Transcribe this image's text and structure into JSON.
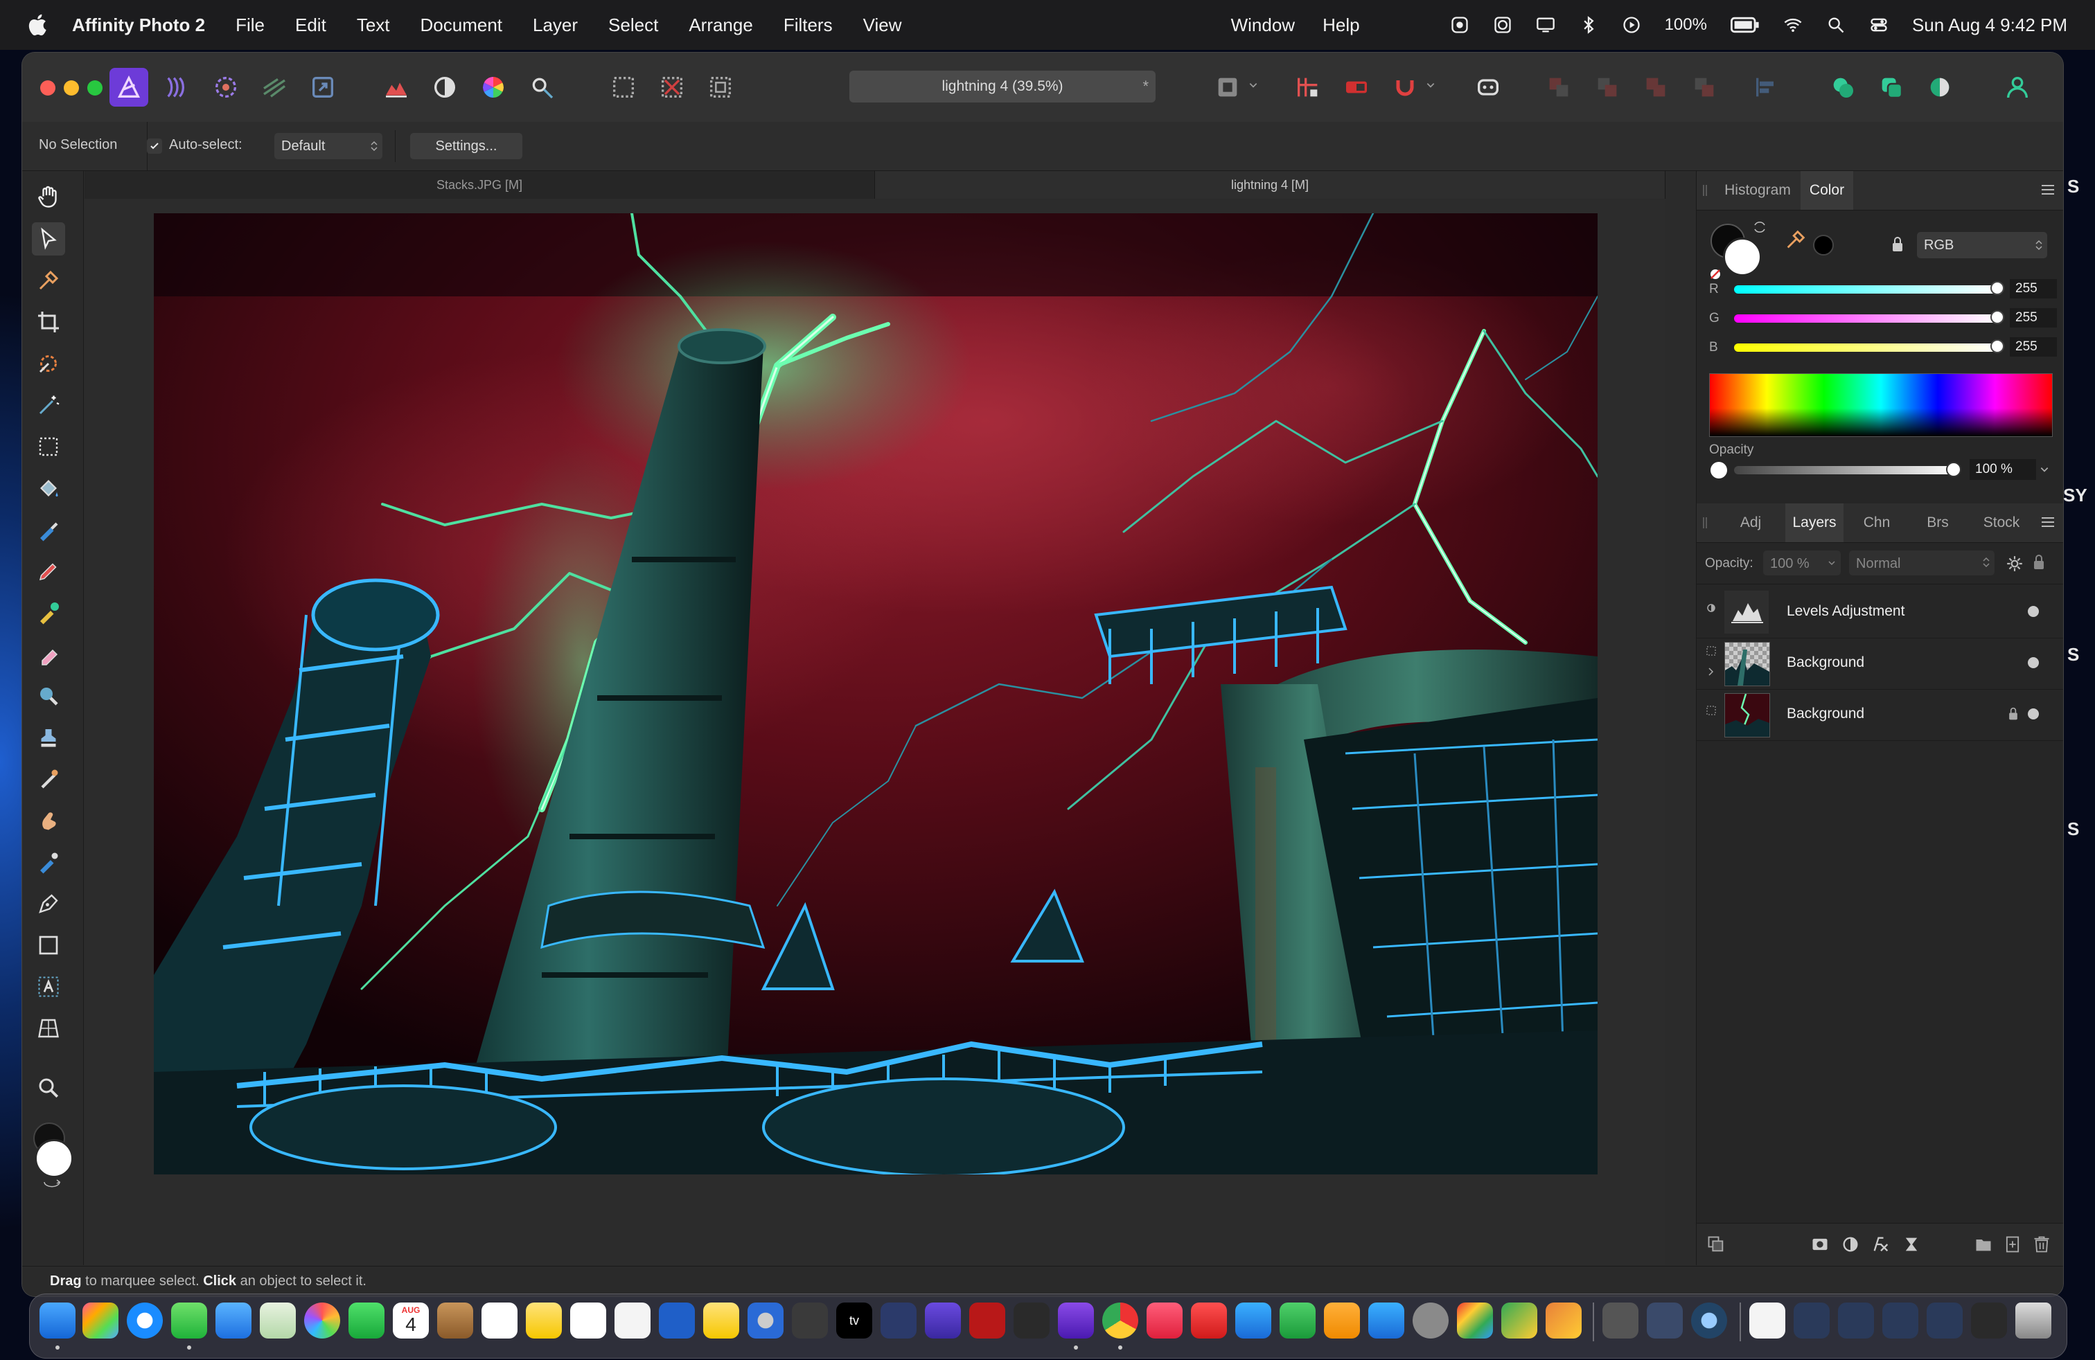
{
  "menubar": {
    "app_name": "Affinity Photo 2",
    "menus": [
      "File",
      "Edit",
      "Text",
      "Document",
      "Layer",
      "Select",
      "Arrange",
      "Filters",
      "View"
    ],
    "right_menus": [
      "Window",
      "Help"
    ],
    "battery": "100%",
    "datetime": "Sun Aug 4  9:42 PM"
  },
  "titlebar": {
    "document_title": "lightning 4 (39.5%)",
    "title_star": "*"
  },
  "contextbar": {
    "selection_status": "No Selection",
    "auto_select_label": "Auto-select:",
    "auto_select_value": "Default",
    "settings_label": "Settings..."
  },
  "document_tabs": [
    {
      "label": "Stacks.JPG [M]",
      "active": false
    },
    {
      "label": "lightning 4 [M]",
      "active": true
    }
  ],
  "color_panel": {
    "tabs": [
      "Histogram",
      "Color"
    ],
    "active_tab": "Color",
    "model": "RGB",
    "channels": [
      {
        "label": "R",
        "value": "255"
      },
      {
        "label": "G",
        "value": "255"
      },
      {
        "label": "B",
        "value": "255"
      }
    ],
    "opacity_label": "Opacity",
    "opacity_value": "100 %"
  },
  "layers_panel": {
    "tabs": [
      "Adj",
      "Layers",
      "Chn",
      "Brs",
      "Stock"
    ],
    "active_tab": "Layers",
    "opacity_label": "Opacity:",
    "opacity_value": "100 %",
    "blend_mode": "Normal",
    "layers": [
      {
        "name": "Levels Adjustment",
        "locked": false
      },
      {
        "name": "Background",
        "locked": false
      },
      {
        "name": "Background",
        "locked": true
      }
    ]
  },
  "statusbar": {
    "drag_word": "Drag",
    "drag_text": " to marquee select. ",
    "click_word": "Click",
    "click_text": " an object to select it."
  },
  "desktop_edge_text": [
    "S",
    "SY",
    "S",
    "S"
  ],
  "dock": {
    "calendar_month": "AUG",
    "calendar_day": "4",
    "tv_label": "tv"
  },
  "colors": {
    "accent": "#3d7bdc",
    "sky_red": "#5a0c18",
    "lightning_green": "#4cff9a",
    "structure_cyan": "#39b8ff"
  }
}
